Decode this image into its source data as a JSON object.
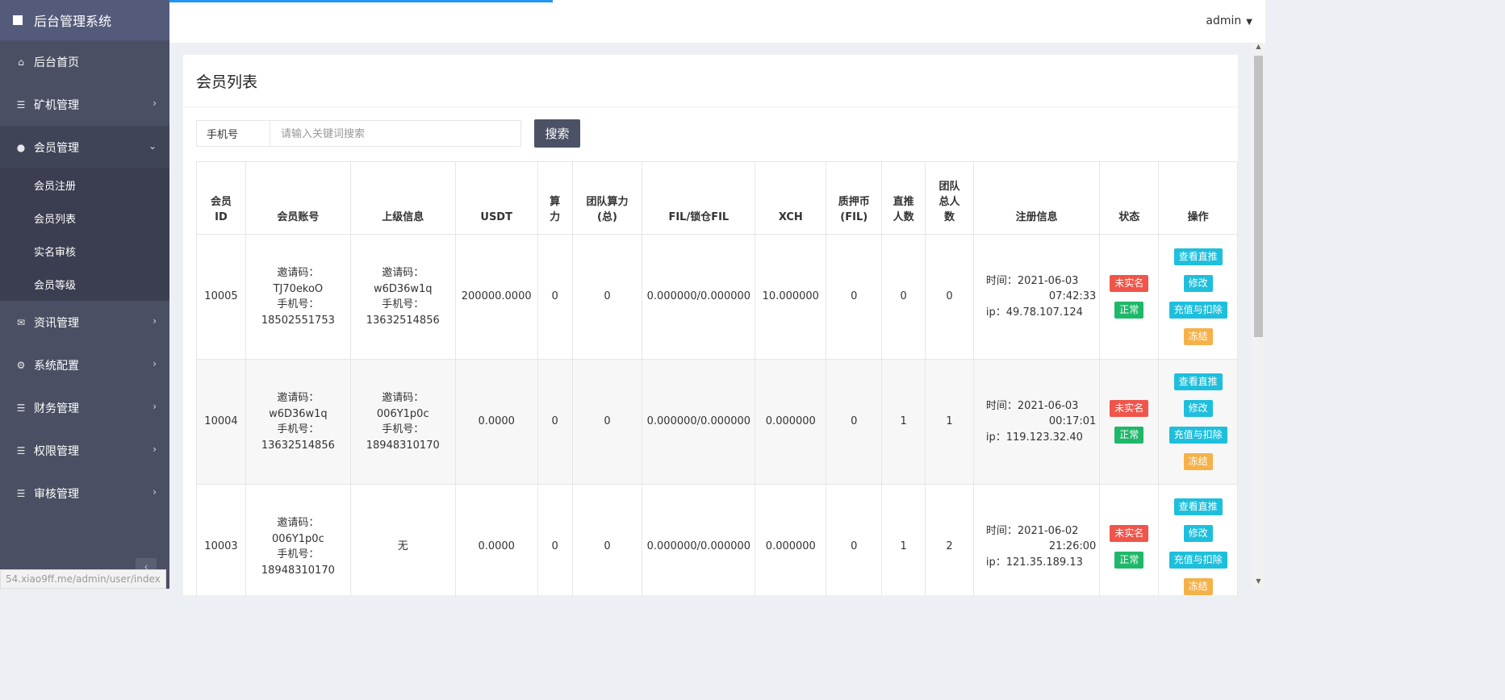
{
  "app": {
    "title": "后台管理系统"
  },
  "sidebar": {
    "items": [
      {
        "label": "后台首页",
        "icon": "home-icon"
      },
      {
        "label": "矿机管理",
        "icon": "list-icon"
      },
      {
        "label": "会员管理",
        "icon": "user-icon",
        "submenu": [
          "会员注册",
          "会员列表",
          "实名审核",
          "会员等级"
        ]
      },
      {
        "label": "资讯管理",
        "icon": "envelope-icon"
      },
      {
        "label": "系统配置",
        "icon": "gears-icon"
      },
      {
        "label": "财务管理",
        "icon": "list-icon"
      },
      {
        "label": "权限管理",
        "icon": "list-icon"
      },
      {
        "label": "审核管理",
        "icon": "list-icon"
      }
    ],
    "collapse_icon": "chevron-left-icon"
  },
  "status_url": "54.xiao9ff.me/admin/user/index",
  "header": {
    "user": "admin"
  },
  "page": {
    "title": "会员列表"
  },
  "search": {
    "label": "手机号",
    "placeholder": "请输入关键词搜索",
    "button": "搜索"
  },
  "table": {
    "headers": [
      "会员ID",
      "会员账号",
      "上级信息",
      "USDT",
      "算力",
      "团队算力(总)",
      "FIL/锁仓FIL",
      "XCH",
      "质押币(FIL)",
      "直推人数",
      "团队总人数",
      "注册信息",
      "状态",
      "操作"
    ],
    "rows": [
      {
        "id": "10005",
        "account": [
          "邀请码：",
          "TJ70ekoO",
          "手机号：",
          "18502551753"
        ],
        "parent": [
          "邀请码：",
          "w6D36w1q",
          "手机号：",
          "13632514856"
        ],
        "usdt": "200000.0000",
        "power": "0",
        "team_power": "0",
        "fil": "0.000000/0.000000",
        "xch": "10.000000",
        "pledge": "0",
        "direct": "0",
        "team": "0",
        "reg": [
          "时间：2021-06-03",
          "07:42:33",
          "ip：49.78.107.124"
        ],
        "status": [
          "未实名",
          "正常"
        ],
        "ops": [
          "查看直推",
          "修改",
          "充值与扣除",
          "冻结"
        ]
      },
      {
        "id": "10004",
        "account": [
          "邀请码：",
          "w6D36w1q",
          "手机号：",
          "13632514856"
        ],
        "parent": [
          "邀请码：",
          "006Y1p0c",
          "手机号：",
          "18948310170"
        ],
        "usdt": "0.0000",
        "power": "0",
        "team_power": "0",
        "fil": "0.000000/0.000000",
        "xch": "0.000000",
        "pledge": "0",
        "direct": "1",
        "team": "1",
        "reg": [
          "时间：2021-06-03",
          "00:17:01",
          "ip：119.123.32.40"
        ],
        "status": [
          "未实名",
          "正常"
        ],
        "ops": [
          "查看直推",
          "修改",
          "充值与扣除",
          "冻结"
        ]
      },
      {
        "id": "10003",
        "account": [
          "邀请码：",
          "006Y1p0c",
          "手机号：",
          "18948310170"
        ],
        "parent": [
          "无"
        ],
        "usdt": "0.0000",
        "power": "0",
        "team_power": "0",
        "fil": "0.000000/0.000000",
        "xch": "0.000000",
        "pledge": "0",
        "direct": "1",
        "team": "2",
        "reg": [
          "时间：2021-06-02",
          "21:26:00",
          "ip：121.35.189.13"
        ],
        "status": [
          "未实名",
          "正常"
        ],
        "ops": [
          "查看直推",
          "修改",
          "充值与扣除",
          "冻结"
        ]
      }
    ]
  }
}
